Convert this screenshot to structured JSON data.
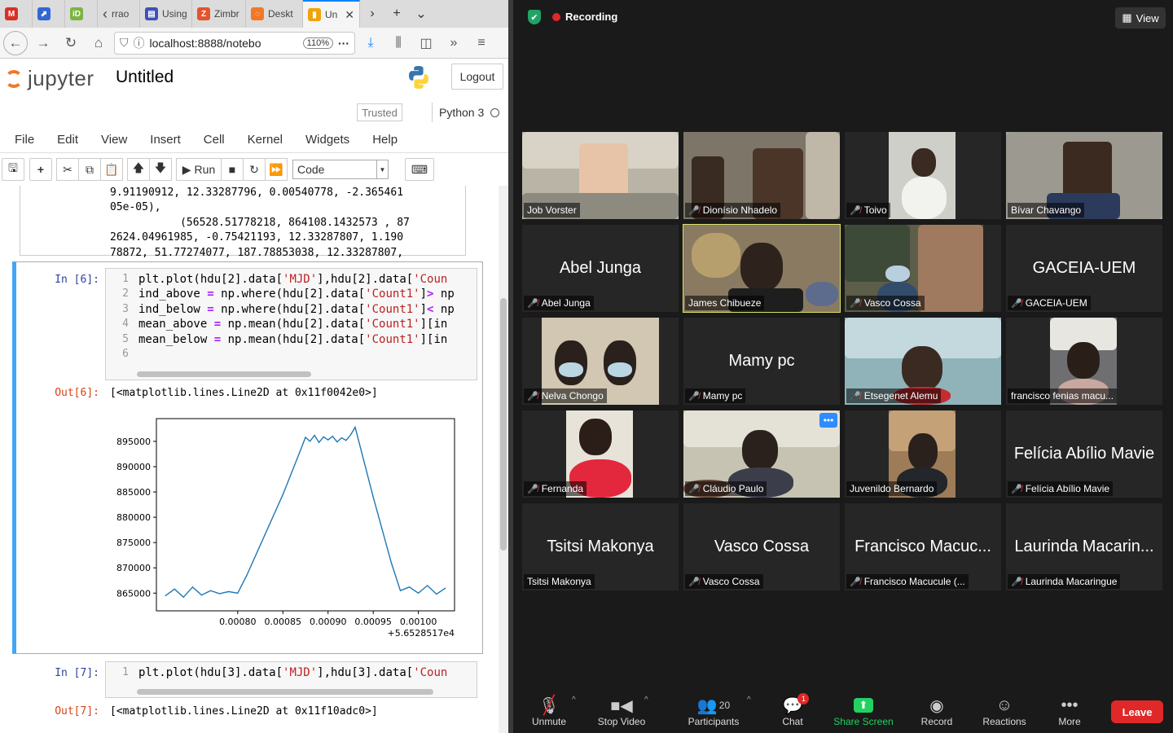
{
  "browser": {
    "tabs": [
      {
        "label": "",
        "icon": "gmail-icon",
        "color": "#d93025",
        "glyph": "M"
      },
      {
        "label": "",
        "icon": "app-icon",
        "color": "#3367d6",
        "glyph": "⬈"
      },
      {
        "label": "",
        "icon": "id-icon",
        "color": "#7cb342",
        "glyph": "iD"
      },
      {
        "label": "rrao",
        "icon": "page-icon",
        "color": "#888888",
        "glyph": ""
      },
      {
        "label": "Using",
        "icon": "doc-icon",
        "color": "#3f51b5",
        "glyph": "▤"
      },
      {
        "label": "Zimbr",
        "icon": "zimbra-icon",
        "color": "#e5532d",
        "glyph": "Z"
      },
      {
        "label": "Deskt",
        "icon": "jupyter-tab-icon",
        "color": "#f37726",
        "glyph": "◌"
      },
      {
        "label": "Un",
        "icon": "notebook-tab-icon",
        "color": "#f0a30a",
        "glyph": "▮"
      }
    ],
    "url": "localhost:8888/notebo",
    "zoom": "110%"
  },
  "jupyter": {
    "logo_text": "jupyter",
    "title": "Untitled",
    "logout": "Logout",
    "trusted": "Trusted",
    "kernel": "Python 3",
    "menu": [
      "File",
      "Edit",
      "View",
      "Insert",
      "Cell",
      "Kernel",
      "Widgets",
      "Help"
    ],
    "run_label": "Run",
    "cell_type": "Code",
    "prev_output": [
      "9.91190912, 12.33287796, 0.00540778, -2.365461",
      "05e-05),",
      "           (56528.51778218, 864108.1432573 , 87",
      "2624.04961985, -0.75421193, 12.33287807, 1.190",
      "78872, 51.77274077, 187.78853038, 12.33287807,"
    ],
    "cell6": {
      "in_prompt": "In [6]:",
      "out_prompt": "Out[6]:",
      "out_text": "[<matplotlib.lines.Line2D at 0x11f0042e0>]",
      "line_numbers": [
        "1",
        "2",
        "3",
        "4",
        "5",
        "6"
      ]
    },
    "cell7": {
      "in_prompt": "In [7]:",
      "out_prompt": "Out[7]:",
      "out_text": "[<matplotlib.lines.Line2D at 0x11f10adc0>]",
      "line_numbers": [
        "1"
      ]
    }
  },
  "chart_data": {
    "type": "line",
    "title": "",
    "xlabel": "",
    "ylabel": "",
    "offset_label": "+5.6528517e4",
    "xticks": [
      "0.00080",
      "0.00085",
      "0.00090",
      "0.00095",
      "0.00100"
    ],
    "yticks": [
      "865000",
      "870000",
      "875000",
      "880000",
      "885000",
      "890000",
      "895000"
    ],
    "xlim": [
      0.00071,
      0.00104
    ],
    "ylim": [
      861500,
      899500
    ],
    "series": [
      {
        "color": "#1f77b4",
        "x": [
          0.00072,
          0.00073,
          0.00074,
          0.00075,
          0.00076,
          0.00077,
          0.00078,
          0.00079,
          0.0008,
          0.00081,
          0.00083,
          0.00085,
          0.00087,
          0.000875,
          0.00088,
          0.000885,
          0.00089,
          0.000895,
          0.0009,
          0.000905,
          0.00091,
          0.000915,
          0.00092,
          0.000925,
          0.00093,
          0.00095,
          0.00097,
          0.00098,
          0.00099,
          0.001,
          0.00101,
          0.00102,
          0.00103
        ],
        "y": [
          864500,
          865800,
          864200,
          866200,
          864600,
          865500,
          864900,
          865300,
          865000,
          868500,
          876500,
          884500,
          893500,
          895800,
          895000,
          896200,
          894800,
          895900,
          895300,
          896000,
          894900,
          895700,
          895200,
          896300,
          897800,
          884000,
          871000,
          865500,
          866200,
          865000,
          866500,
          864800,
          866000
        ]
      }
    ]
  },
  "zoom": {
    "recording": "Recording",
    "view": "View",
    "participants": [
      {
        "name": "Job Vorster",
        "big": "",
        "muted": false,
        "video": "light"
      },
      {
        "name": "Dionísio Nhadelo",
        "big": "",
        "muted": true,
        "video": "two"
      },
      {
        "name": "Toivo",
        "big": "",
        "muted": true,
        "video": "narrow"
      },
      {
        "name": "Bívar Chavango",
        "big": "",
        "muted": false,
        "video": "glasses"
      },
      {
        "name": "Abel Junga",
        "big": "Abel Junga",
        "muted": true,
        "video": ""
      },
      {
        "name": "James Chibueze",
        "big": "",
        "muted": false,
        "video": "office",
        "selected": true
      },
      {
        "name": "Vasco Cossa",
        "big": "",
        "muted": true,
        "video": "window"
      },
      {
        "name": "GACEIA-UEM",
        "big": "GACEIA-UEM",
        "muted": true,
        "video": ""
      },
      {
        "name": "Nelva Chongo",
        "big": "",
        "muted": true,
        "video": "masks"
      },
      {
        "name": "Mamy pc",
        "big": "Mamy pc",
        "muted": true,
        "video": ""
      },
      {
        "name": "Etsegenet Alemu",
        "big": "",
        "muted": true,
        "video": "smile"
      },
      {
        "name": "francisco fenias macu...",
        "big": "",
        "muted": false,
        "video": "headset"
      },
      {
        "name": "Fernanda",
        "big": "",
        "muted": true,
        "video": "red"
      },
      {
        "name": "Cláudio Paulo",
        "big": "",
        "muted": true,
        "video": "desk",
        "more": true
      },
      {
        "name": "Juvenildo Bernardo",
        "big": "",
        "muted": false,
        "video": "narrow2"
      },
      {
        "name": "Felícia Abílio Mavie",
        "big": "Felícia Abílio Mavie",
        "muted": true,
        "video": ""
      },
      {
        "name": "Tsitsi Makonya",
        "big": "Tsitsi Makonya",
        "muted": false,
        "video": ""
      },
      {
        "name": "Vasco Cossa",
        "big": "Vasco Cossa",
        "muted": true,
        "video": ""
      },
      {
        "name": "Francisco Macucule (...",
        "big": "Francisco Macuc...",
        "muted": true,
        "video": ""
      },
      {
        "name": "Laurinda Macaringue",
        "big": "Laurinda Macarin...",
        "muted": true,
        "video": ""
      }
    ],
    "controls": {
      "unmute": "Unmute",
      "stop_video": "Stop Video",
      "participants": "Participants",
      "participants_count": "20",
      "chat": "Chat",
      "chat_badge": "1",
      "share": "Share Screen",
      "record": "Record",
      "reactions": "Reactions",
      "more": "More",
      "leave": "Leave"
    }
  }
}
